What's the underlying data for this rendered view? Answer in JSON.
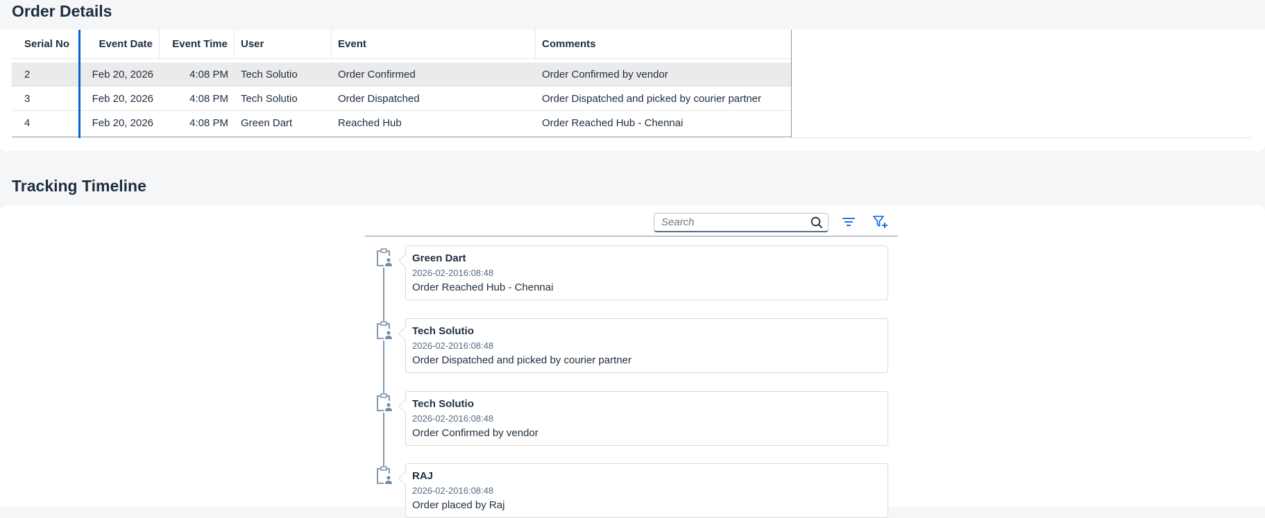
{
  "order_details": {
    "title": "Order Details",
    "columns": {
      "serial": "Serial No",
      "date": "Event Date",
      "time": "Event Time",
      "user": "User",
      "event": "Event",
      "comments": "Comments"
    },
    "rows": [
      {
        "serial": "2",
        "date": "Feb 20, 2026",
        "time": "4:08 PM",
        "user": "Tech Solutio",
        "event": "Order Confirmed",
        "comments": "Order Confirmed by vendor",
        "selected": true
      },
      {
        "serial": "3",
        "date": "Feb 20, 2026",
        "time": "4:08 PM",
        "user": "Tech Solutio",
        "event": "Order Dispatched",
        "comments": "Order Dispatched and picked by courier partner",
        "selected": false
      },
      {
        "serial": "4",
        "date": "Feb 20, 2026",
        "time": "4:08 PM",
        "user": "Green Dart",
        "event": "Reached Hub",
        "comments": "Order Reached Hub - Chennai",
        "selected": false
      }
    ]
  },
  "tracking": {
    "title": "Tracking Timeline",
    "search": {
      "placeholder": "Search",
      "icon": "search-icon"
    },
    "sort_icon": "sort-icon",
    "filter_icon": "filter-add-icon",
    "item_icon": "clipboard-user-icon",
    "items": [
      {
        "user": "Green Dart",
        "timestamp": "2026-02-2016:08:48",
        "message": "Order Reached Hub - Chennai"
      },
      {
        "user": "Tech Solutio",
        "timestamp": "2026-02-2016:08:48",
        "message": "Order Dispatched and picked by courier partner"
      },
      {
        "user": "Tech Solutio",
        "timestamp": "2026-02-2016:08:48",
        "message": "Order Confirmed by vendor"
      },
      {
        "user": "RAJ",
        "timestamp": "2026-02-2016:08:48",
        "message": "Order placed by Raj"
      }
    ]
  },
  "colors": {
    "accent": "#0064d9",
    "page_bg": "#f5f6f7",
    "selected_row": "#ebebeb",
    "text": "#1d2d3e",
    "muted_text": "#556b82"
  }
}
